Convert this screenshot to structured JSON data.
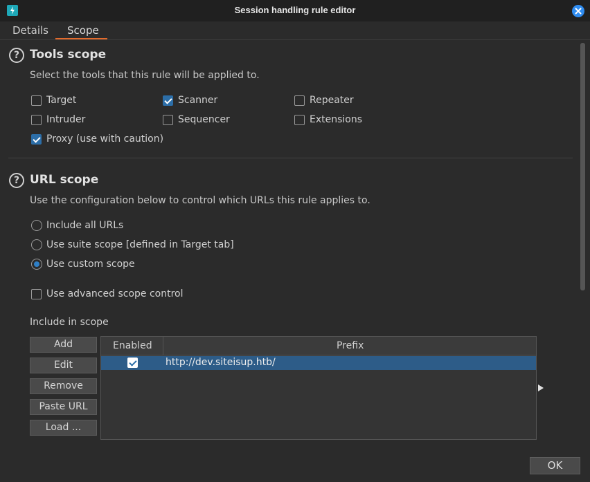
{
  "window": {
    "title": "Session handling rule editor"
  },
  "tabs": [
    {
      "label": "Details"
    },
    {
      "label": "Scope"
    }
  ],
  "tools_scope": {
    "title": "Tools scope",
    "description": "Select the tools that this rule will be applied to.",
    "options": [
      {
        "label": "Target",
        "checked": false
      },
      {
        "label": "Scanner",
        "checked": true
      },
      {
        "label": "Repeater",
        "checked": false
      },
      {
        "label": "Intruder",
        "checked": false
      },
      {
        "label": "Sequencer",
        "checked": false
      },
      {
        "label": "Extensions",
        "checked": false
      },
      {
        "label": "Proxy (use with caution)",
        "checked": true
      }
    ]
  },
  "url_scope": {
    "title": "URL scope",
    "description": "Use the configuration below to control which URLs this rule applies to.",
    "radios": [
      {
        "label": "Include all URLs",
        "selected": false
      },
      {
        "label": "Use suite scope [defined in Target tab]",
        "selected": false
      },
      {
        "label": "Use custom scope",
        "selected": true
      }
    ],
    "advanced": {
      "label": "Use advanced scope control",
      "checked": false
    }
  },
  "include_scope": {
    "label": "Include in scope",
    "buttons": [
      "Add",
      "Edit",
      "Remove",
      "Paste URL",
      "Load ..."
    ],
    "columns": [
      "Enabled",
      "Prefix"
    ],
    "rows": [
      {
        "enabled": true,
        "prefix": "http://dev.siteisup.htb/"
      }
    ]
  },
  "footer": {
    "ok_label": "OK"
  },
  "colors": {
    "accent": "#e36b2c",
    "selection": "#2d5c88",
    "check": "#2c6ea8",
    "close": "#2f8cf0"
  }
}
